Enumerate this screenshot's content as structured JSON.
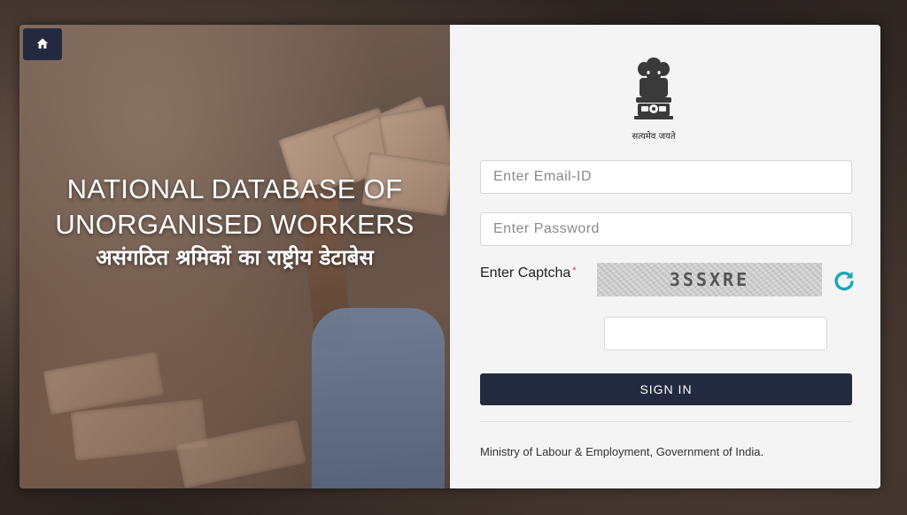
{
  "hero": {
    "title_en_line1": "NATIONAL DATABASE OF",
    "title_en_line2": "UNORGANISED WORKERS",
    "title_hi": "असंगठित श्रमिकों का राष्ट्रीय डेटाबेस",
    "home_icon": "home-icon"
  },
  "emblem": {
    "icon": "national-emblem-icon",
    "motto": "सत्यमेव जयते"
  },
  "login": {
    "email_placeholder": "Enter Email-ID",
    "email_value": "",
    "password_placeholder": "Enter Password",
    "password_value": "",
    "captcha_label": "Enter Captcha",
    "captcha_required_mark": "*",
    "captcha_code": "3SSXRE",
    "captcha_value": "",
    "refresh_icon": "refresh-icon",
    "signin_label": "SIGN IN"
  },
  "footer": {
    "text": "Ministry of Labour & Employment, Government of India."
  },
  "colors": {
    "primary_dark": "#232a3f",
    "panel_bg": "#f4f4f4",
    "refresh_accent": "#1aa6b7",
    "required_mark": "#dd3333"
  }
}
